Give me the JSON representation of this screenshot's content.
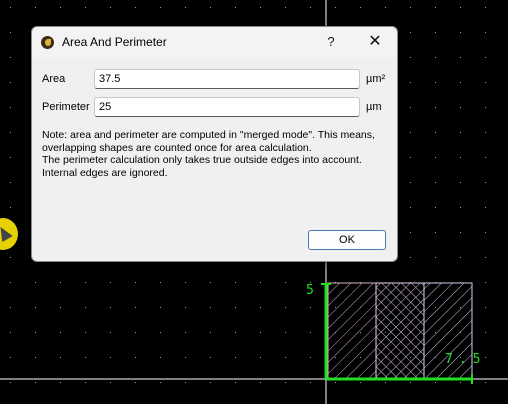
{
  "dialog": {
    "title": "Area And Perimeter",
    "help_label": "?",
    "close_label": "✕",
    "area_label": "Area",
    "area_value": "37.5",
    "area_unit": "µm²",
    "perimeter_label": "Perimeter",
    "perimeter_value": "25",
    "perimeter_unit": "µm",
    "note": "Note: area and perimeter are computed in \"merged mode\". This means, overlapping shapes are counted once for area calculation.\nThe perimeter calculation only takes true outside edges into account.\nInternal edges are ignored.",
    "ok_label": "OK"
  },
  "canvas": {
    "height_dimension": "5",
    "width_dimension": "7.5",
    "ruler_color": "#22dd22",
    "background_color": "#000000"
  }
}
